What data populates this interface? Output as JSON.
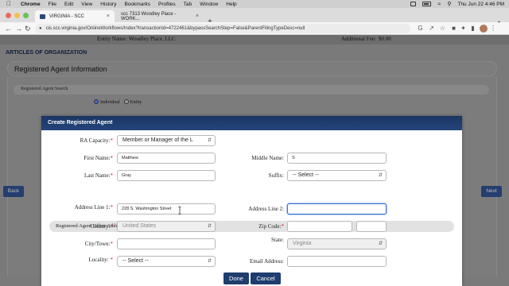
{
  "menubar": {
    "app": "Chrome",
    "items": [
      "File",
      "Edit",
      "View",
      "History",
      "Bookmarks",
      "Profiles",
      "Tab",
      "Window",
      "Help"
    ],
    "clock": "Thu Jun 22  4:46 PM"
  },
  "tabs": [
    {
      "title": "VIRGINIA - SCC"
    },
    {
      "title": "scc  7313 Woodley Place - WORK..."
    }
  ],
  "url": "cis.scc.virginia.gov/OnlineWorkflows/Index?transactionId=4722461&bypassSearchStep=False&ParentFilingTypeDesc=null",
  "entity": {
    "name_label": "Entity Name:",
    "name_value": "Woodley Place, LLC",
    "fee_label": "Additional Fee:",
    "fee_value": "$0.00"
  },
  "page": {
    "section_title": "ARTICLES OF ORGANIZATION",
    "ra_info_header": "Registered Agent Information",
    "ra_search_header": "Registered Agent Search",
    "radio_individual": "Individual",
    "radio_entity": "Entity",
    "back_label": "Back",
    "next_label": "Next"
  },
  "modal": {
    "title": "Create Registered Agent",
    "ra_capacity": {
      "label": "RA Capacity:",
      "value": "Member or Manager of the L"
    },
    "first_name": {
      "label": "First Name:",
      "value": "Matthew"
    },
    "middle_name": {
      "label": "Middle Name:",
      "value": "S"
    },
    "last_name": {
      "label": "Last Name:",
      "value": "Gray"
    },
    "suffix": {
      "label": "Suffix:",
      "value": "-- Select --"
    },
    "office_header": "Registered Agent Office Address",
    "address1": {
      "label": "Address Line 1:",
      "value": "228 S. Washington Street"
    },
    "address2": {
      "label": "Address Line 2:",
      "value": ""
    },
    "country": {
      "label": "Country:",
      "value": "United States"
    },
    "zip": {
      "label": "Zip Code:",
      "value": ""
    },
    "city": {
      "label": "City/Town:",
      "value": ""
    },
    "state": {
      "label": "State:",
      "value": "Virginia"
    },
    "locality": {
      "label": "Locality:",
      "value": "-- Select --"
    },
    "email": {
      "label": "Email Address:",
      "value": ""
    },
    "done_label": "Done",
    "cancel_label": "Cancel",
    "required_mark": "*"
  }
}
